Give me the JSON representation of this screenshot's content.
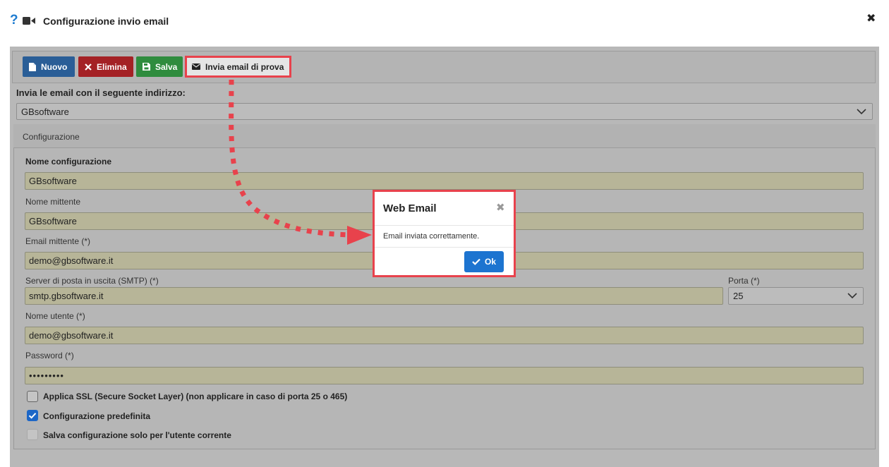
{
  "window": {
    "title": "Configurazione invio email",
    "help_glyph": "?",
    "close_glyph": "✖"
  },
  "toolbar": {
    "new_label": "Nuovo",
    "delete_label": "Elimina",
    "save_label": "Salva",
    "test_label": "Invia email di prova"
  },
  "sender": {
    "label": "Invia le email con il seguente indirizzo:",
    "selected": "GBsoftware"
  },
  "config": {
    "section_title": "Configurazione",
    "name_label": "Nome configurazione",
    "name_value": "GBsoftware",
    "sender_name_label": "Nome mittente",
    "sender_name_value": "GBsoftware",
    "sender_email_label": "Email mittente (*)",
    "sender_email_value": "demo@gbsoftware.it",
    "smtp_label": "Server di posta in uscita (SMTP) (*)",
    "smtp_value": "smtp.gbsoftware.it",
    "port_label": "Porta (*)",
    "port_value": "25",
    "username_label": "Nome utente (*)",
    "username_value": "demo@gbsoftware.it",
    "password_label": "Password (*)",
    "password_value": "•••••••••",
    "ssl_label": "Applica SSL (Secure Socket Layer) (non applicare in caso di porta 25 o 465)",
    "ssl_checked": false,
    "default_label": "Configurazione predefinita",
    "default_checked": true,
    "user_only_label": "Salva configurazione solo per l'utente corrente",
    "user_only_checked": false
  },
  "modal": {
    "title": "Web Email",
    "message": "Email inviata correttamente.",
    "ok_label": "Ok",
    "close_glyph": "✖"
  },
  "colors": {
    "primary": "#2a5e97",
    "danger": "#a42125",
    "success": "#2f8c3e",
    "highlight": "#e8424c",
    "ok": "#1d74d0"
  },
  "icons": {
    "help": "question-icon",
    "video": "video-camera-icon",
    "new": "file-icon",
    "delete": "times-icon",
    "save": "floppy-icon",
    "test": "envelope-icon",
    "ok": "check-icon"
  }
}
